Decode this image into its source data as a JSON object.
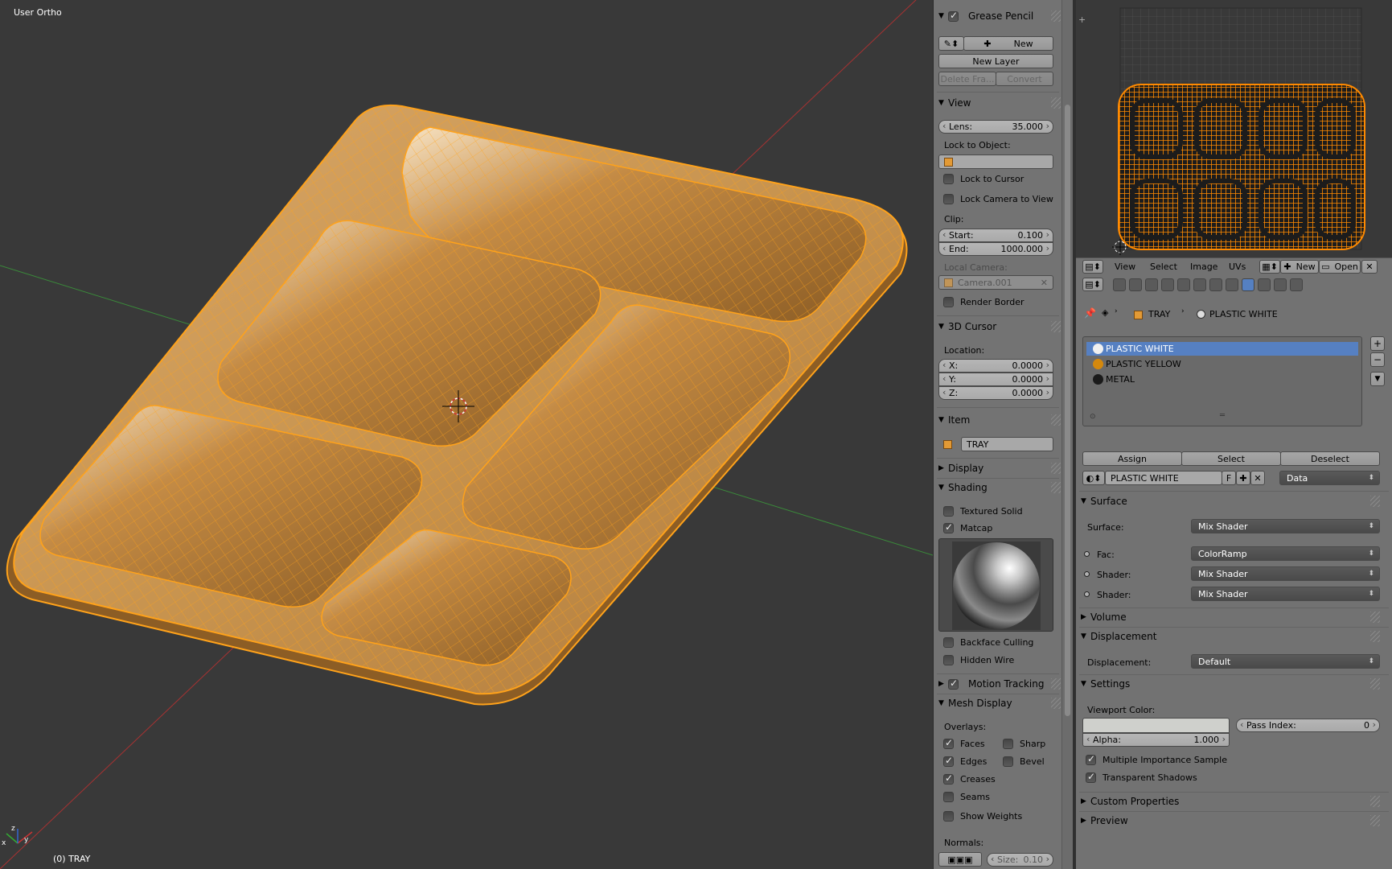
{
  "viewport": {
    "view_label": "User Ortho",
    "object_label": "(0) TRAY",
    "colors": {
      "background": "#393939",
      "mesh": "#c8934f",
      "wire": "#ffa21a",
      "axis_x": "#a83232",
      "axis_y": "#3a8a3a"
    }
  },
  "npanel": {
    "grease_pencil": {
      "title": "Grease Pencil",
      "new": "New",
      "new_layer": "New Layer",
      "delete_frame": "Delete Fra...",
      "convert": "Convert"
    },
    "view": {
      "title": "View",
      "lens_label": "Lens:",
      "lens_value": "35.000",
      "lock_to_object": "Lock to Object:",
      "lock_to_cursor": "Lock to Cursor",
      "lock_camera_to_view": "Lock Camera to View",
      "clip": "Clip:",
      "start_label": "Start:",
      "start_value": "0.100",
      "end_label": "End:",
      "end_value": "1000.000",
      "local_camera": "Local Camera:",
      "camera_name": "Camera.001",
      "render_border": "Render Border"
    },
    "cursor": {
      "title": "3D Cursor",
      "location": "Location:",
      "x_label": "X:",
      "x_value": "0.0000",
      "y_label": "Y:",
      "y_value": "0.0000",
      "z_label": "Z:",
      "z_value": "0.0000"
    },
    "item": {
      "title": "Item",
      "name": "TRAY"
    },
    "display": {
      "title": "Display"
    },
    "shading": {
      "title": "Shading",
      "textured_solid": "Textured Solid",
      "matcap": "Matcap",
      "backface_culling": "Backface Culling",
      "hidden_wire": "Hidden Wire"
    },
    "motion_tracking": {
      "title": "Motion Tracking"
    },
    "mesh_display": {
      "title": "Mesh Display",
      "overlays": "Overlays:",
      "faces": "Faces",
      "sharp": "Sharp",
      "edges": "Edges",
      "bevel": "Bevel",
      "creases": "Creases",
      "seams": "Seams",
      "show_weights": "Show Weights",
      "normals": "Normals:",
      "size_label": "Size:",
      "size_value": "0.10"
    }
  },
  "uv_header": {
    "menus": [
      "View",
      "Select",
      "Image",
      "UVs"
    ],
    "new": "New",
    "open": "Open"
  },
  "properties": {
    "breadcrumb": {
      "object": "TRAY",
      "material": "PLASTIC WHITE"
    },
    "materials": [
      {
        "name": "PLASTIC WHITE",
        "color": "#f0f0f0",
        "selected": true
      },
      {
        "name": "PLASTIC YELLOW",
        "color": "#d4880c",
        "selected": false
      },
      {
        "name": "METAL",
        "color": "#1a1a1a",
        "selected": false
      }
    ],
    "assign": "Assign",
    "select": "Select",
    "deselect": "Deselect",
    "material_name": "PLASTIC WHITE",
    "fake_user": "F",
    "link": "Data",
    "surface": {
      "title": "Surface",
      "surface_label": "Surface:",
      "surface_value": "Mix Shader",
      "fac_label": "Fac:",
      "fac_value": "ColorRamp",
      "shader1_label": "Shader:",
      "shader1_value": "Mix Shader",
      "shader2_label": "Shader:",
      "shader2_value": "Mix Shader"
    },
    "volume": {
      "title": "Volume"
    },
    "displacement": {
      "title": "Displacement",
      "label": "Displacement:",
      "value": "Default"
    },
    "settings": {
      "title": "Settings",
      "viewport_color": "Viewport Color:",
      "alpha_label": "Alpha:",
      "alpha_value": "1.000",
      "pass_index_label": "Pass Index:",
      "pass_index_value": "0",
      "multiple_importance": "Multiple Importance Sample",
      "transparent_shadows": "Transparent Shadows"
    },
    "custom_properties": {
      "title": "Custom Properties"
    },
    "preview": {
      "title": "Preview"
    }
  }
}
